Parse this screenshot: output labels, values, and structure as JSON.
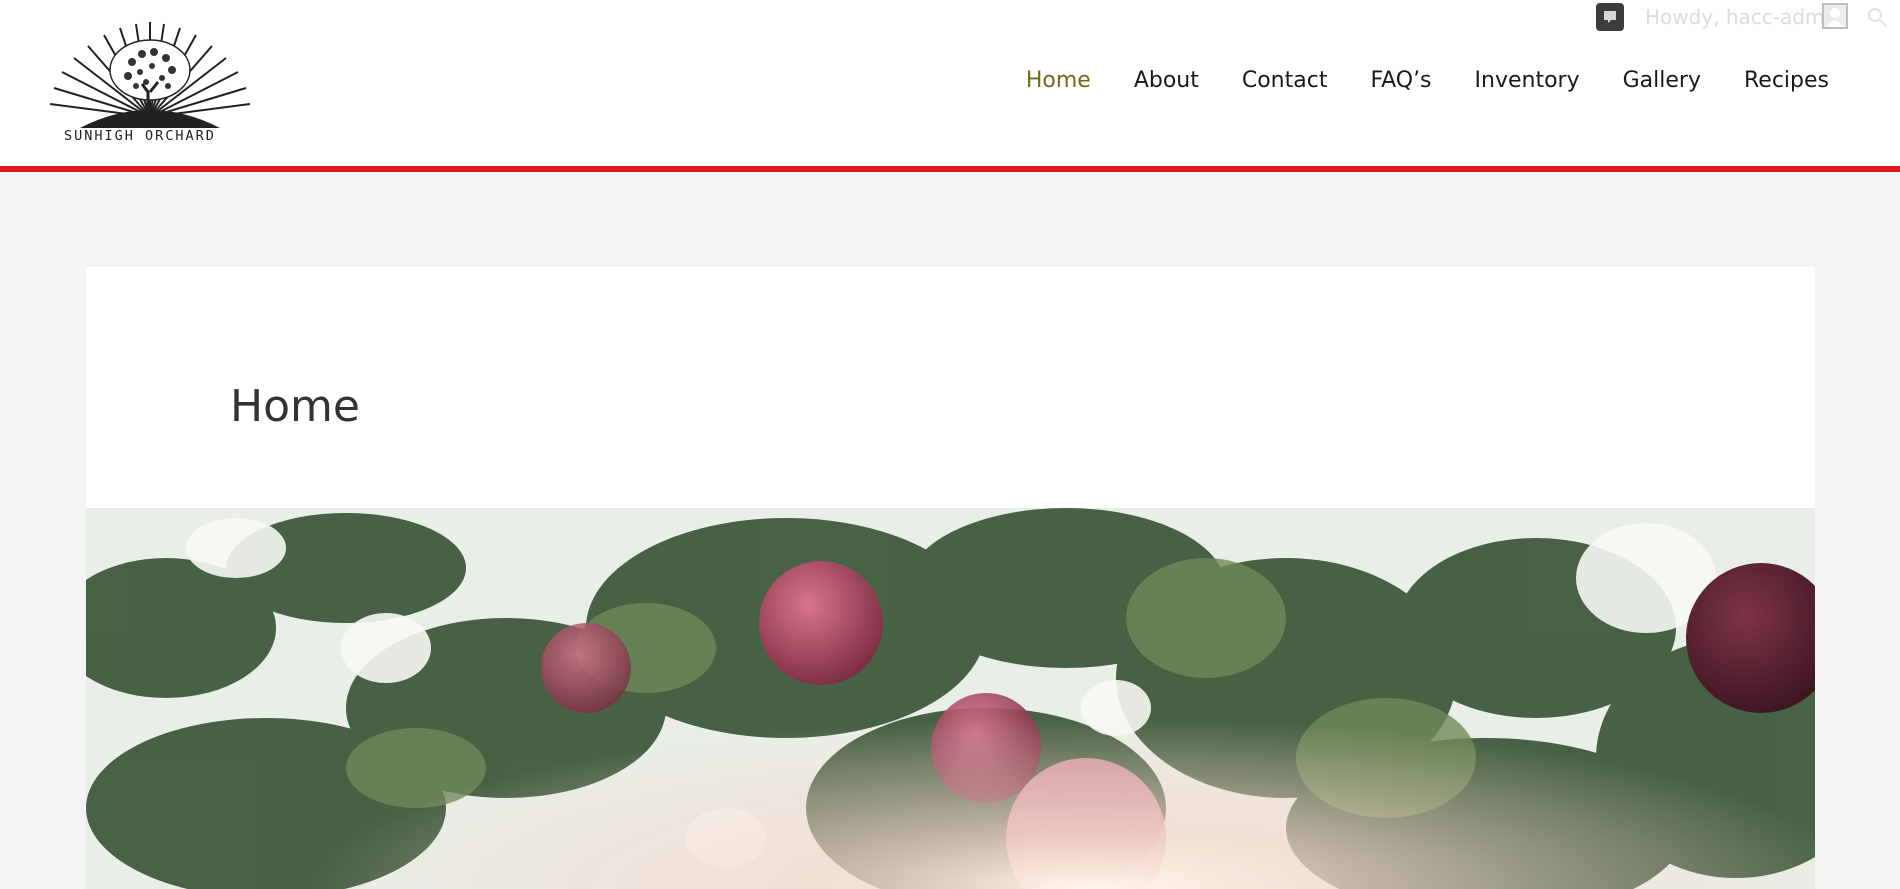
{
  "admin_bar": {
    "greeting": "Howdy, hacc-admin",
    "icons": [
      "comments-icon",
      "avatar",
      "search-icon"
    ]
  },
  "site": {
    "logo_text": "SUNHIGH ORCHARD"
  },
  "nav": {
    "items": [
      {
        "label": "Home",
        "active": true
      },
      {
        "label": "About"
      },
      {
        "label": "Contact"
      },
      {
        "label": "FAQ’s"
      },
      {
        "label": "Inventory"
      },
      {
        "label": "Gallery"
      },
      {
        "label": "Recipes"
      }
    ]
  },
  "page": {
    "title": "Home",
    "hero_subject": "apples on a tree branch with sunlight"
  },
  "colors": {
    "accent_border": "#e0191e",
    "active_nav": "#6f6a18",
    "background": "#f4f4f4"
  }
}
